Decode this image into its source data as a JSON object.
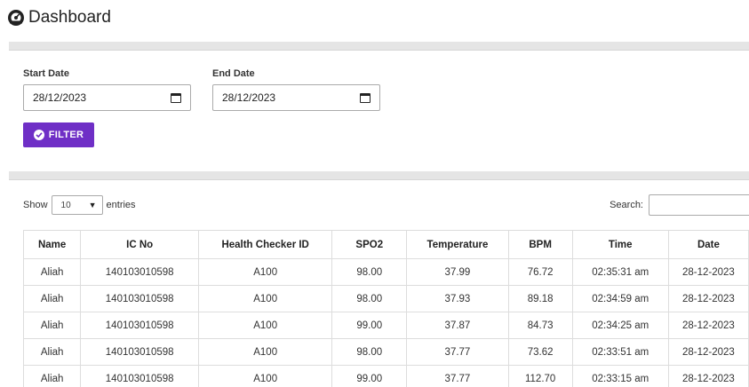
{
  "header": {
    "title": "Dashboard",
    "icon": "dashboard-icon"
  },
  "filter": {
    "start_label": "Start Date",
    "start_value": "28/12/2023",
    "end_label": "End Date",
    "end_value": "28/12/2023",
    "button_label": "FILTER",
    "button_color": "#6f2fc6"
  },
  "table_controls": {
    "show_label": "Show",
    "entries_value": "10",
    "entries_label": "entries",
    "search_label": "Search:"
  },
  "table": {
    "columns": [
      "Name",
      "IC No",
      "Health Checker ID",
      "SPO2",
      "Temperature",
      "BPM",
      "Time",
      "Date"
    ],
    "rows": [
      [
        "Aliah",
        "140103010598",
        "A100",
        "98.00",
        "37.99",
        "76.72",
        "02:35:31 am",
        "28-12-2023"
      ],
      [
        "Aliah",
        "140103010598",
        "A100",
        "98.00",
        "37.93",
        "89.18",
        "02:34:59 am",
        "28-12-2023"
      ],
      [
        "Aliah",
        "140103010598",
        "A100",
        "99.00",
        "37.87",
        "84.73",
        "02:34:25 am",
        "28-12-2023"
      ],
      [
        "Aliah",
        "140103010598",
        "A100",
        "98.00",
        "37.77",
        "73.62",
        "02:33:51 am",
        "28-12-2023"
      ],
      [
        "Aliah",
        "140103010598",
        "A100",
        "99.00",
        "37.77",
        "112.70",
        "02:33:15 am",
        "28-12-2023"
      ]
    ]
  }
}
